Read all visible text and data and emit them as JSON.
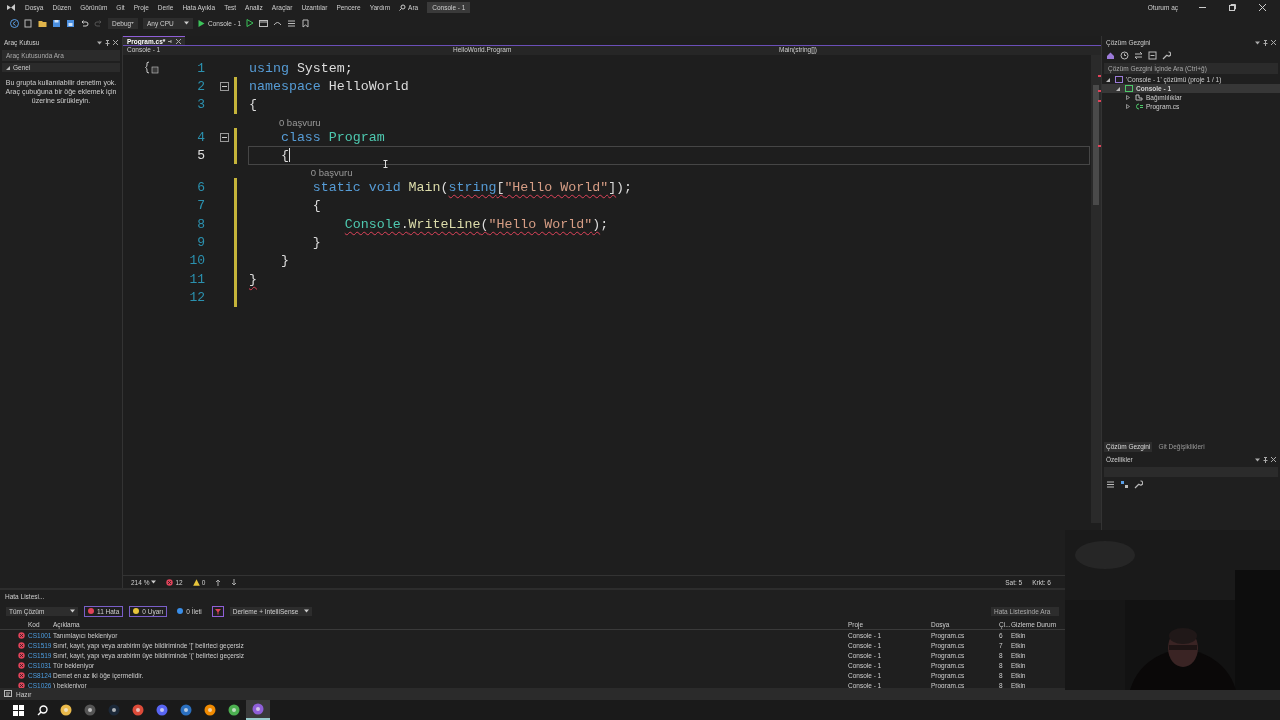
{
  "menu": {
    "items": [
      "Dosya",
      "Düzen",
      "Görünüm",
      "Git",
      "Proje",
      "Derle",
      "Hata Ayıkla",
      "Test",
      "Analiz",
      "Araçlar",
      "Uzantılar",
      "Pencere",
      "Yardım"
    ],
    "search": "Ara",
    "solution_title": "Console - 1",
    "sign_in": "Oturum aç"
  },
  "toolbar": {
    "configuration": "Debug",
    "platform": "Any CPU",
    "start_target": "Console - 1"
  },
  "toolbox": {
    "title": "Araç Kutusu",
    "search_placeholder": "Araç Kutusunda Ara",
    "group": "Genel",
    "message": "Bu grupta kullanılabilir denetim yok. Araç çubuğuna bir öğe eklemek için üzerine sürükleyin."
  },
  "editor": {
    "tabs": [
      {
        "label": "Program.cs*",
        "selected": true
      }
    ],
    "nav": {
      "project": "Console - 1",
      "type": "HelloWorld.Program",
      "member": "Main(string[])"
    },
    "lines": [
      {
        "number": "1",
        "current": false,
        "modified": false,
        "foldable": false,
        "tokens": [
          {
            "text": "using",
            "kind": "keyword",
            "error": false
          },
          {
            "text": " System;",
            "kind": "plain",
            "error": false
          }
        ]
      },
      {
        "number": "2",
        "current": false,
        "modified": true,
        "foldable": true,
        "tokens": [
          {
            "text": "namespace",
            "kind": "keyword",
            "error": false
          },
          {
            "text": " HelloWorld",
            "kind": "plain",
            "error": false
          }
        ]
      },
      {
        "number": "3",
        "current": false,
        "modified": true,
        "foldable": false,
        "tokens": [
          {
            "text": "{",
            "kind": "plain",
            "error": false
          }
        ]
      },
      {
        "number": "4",
        "current": false,
        "modified": true,
        "foldable": true,
        "hint": "0 başvuru",
        "tokens": [
          {
            "text": "    class",
            "kind": "keyword",
            "error": false
          },
          {
            "text": " Program",
            "kind": "type",
            "error": false
          }
        ]
      },
      {
        "number": "5",
        "current": true,
        "modified": true,
        "foldable": false,
        "tokens": [
          {
            "text": "    {",
            "kind": "plain",
            "error": false
          }
        ]
      },
      {
        "number": "6",
        "current": false,
        "modified": true,
        "foldable": false,
        "hint": "0 başvuru",
        "tokens": [
          {
            "text": "        static void",
            "kind": "keyword",
            "error": false
          },
          {
            "text": " Main",
            "kind": "method",
            "error": false
          },
          {
            "text": "(",
            "kind": "plain",
            "error": false
          },
          {
            "text": "string",
            "kind": "keyword",
            "error": true
          },
          {
            "text": "[",
            "kind": "plain",
            "error": true
          },
          {
            "text": "\"Hello World\"",
            "kind": "string",
            "error": true
          },
          {
            "text": "]",
            "kind": "plain",
            "error": true
          },
          {
            "text": ");",
            "kind": "plain",
            "error": false
          }
        ]
      },
      {
        "number": "7",
        "current": false,
        "modified": true,
        "foldable": false,
        "tokens": [
          {
            "text": "        {",
            "kind": "plain",
            "error": false
          }
        ]
      },
      {
        "number": "8",
        "current": false,
        "modified": true,
        "foldable": false,
        "tokens": [
          {
            "text": "            Console",
            "kind": "type",
            "error": true
          },
          {
            "text": ".",
            "kind": "plain",
            "error": true
          },
          {
            "text": "WriteLine",
            "kind": "method",
            "error": true
          },
          {
            "text": "(",
            "kind": "plain",
            "error": true
          },
          {
            "text": "\"Hello World\"",
            "kind": "string",
            "error": true
          },
          {
            "text": ")",
            "kind": "plain",
            "error": true
          },
          {
            "text": ";",
            "kind": "plain",
            "error": false
          }
        ]
      },
      {
        "number": "9",
        "current": false,
        "modified": true,
        "foldable": false,
        "tokens": [
          {
            "text": "        }",
            "kind": "plain",
            "error": false
          }
        ]
      },
      {
        "number": "10",
        "current": false,
        "modified": true,
        "foldable": false,
        "tokens": [
          {
            "text": "    }",
            "kind": "plain",
            "error": false
          }
        ]
      },
      {
        "number": "11",
        "current": false,
        "modified": true,
        "foldable": false,
        "tokens": [
          {
            "text": "}",
            "kind": "plain",
            "error": true
          }
        ]
      },
      {
        "number": "12",
        "current": false,
        "modified": true,
        "foldable": false
      }
    ],
    "status": {
      "zoom": "214 %",
      "errors": "12",
      "warnings": "0",
      "line": "Sat: 5",
      "column": "Krkt: 6"
    }
  },
  "solution_explorer": {
    "title": "Çözüm Gezgini",
    "search_placeholder": "Çözüm Gezgini İçinde Ara (Ctrl+ğ)",
    "tree": [
      {
        "label": "'Console - 1' çözümü (proje 1 / 1)",
        "kind": "solution",
        "selected": false,
        "expanded": true,
        "children": [
          {
            "label": "Console - 1",
            "kind": "project",
            "selected": true,
            "expanded": true,
            "children": [
              {
                "label": "Bağımlılıklar",
                "kind": "dependencies",
                "selected": false,
                "expanded": false
              },
              {
                "label": "Program.cs",
                "kind": "csharp",
                "selected": false,
                "expanded": false
              }
            ]
          }
        ]
      }
    ],
    "tabs": [
      {
        "label": "Çözüm Gezgini",
        "selected": true
      },
      {
        "label": "Git Değişiklikleri",
        "selected": false
      }
    ]
  },
  "properties": {
    "title": "Özellikler"
  },
  "error_list": {
    "title": "Hata Listesi...",
    "scope": "Tüm Çözüm",
    "filters": [
      {
        "label": "11 Hata",
        "kind": "error",
        "selected": true
      },
      {
        "label": "0 Uyarı",
        "kind": "warning",
        "selected": true
      },
      {
        "label": "0 İleti",
        "kind": "info",
        "selected": false
      }
    ],
    "source": "Derleme + IntelliSense",
    "search_placeholder": "Hata Listesinde Ara",
    "columns": [
      "Kod",
      "Açıklama",
      "Proje",
      "Dosya",
      "Çi...",
      "Gizleme Durum"
    ],
    "rows": [
      {
        "code": "CS1001",
        "description": "Tanımlayıcı bekleniyor",
        "project": "Console - 1",
        "file": "Program.cs",
        "line": "6",
        "suppression": "Etkin"
      },
      {
        "code": "CS1519",
        "description": "Sınıf, kayıt, yapı veya arabirim üye bildiriminde '[' belirteci geçersiz",
        "project": "Console - 1",
        "file": "Program.cs",
        "line": "7",
        "suppression": "Etkin"
      },
      {
        "code": "CS1519",
        "description": "Sınıf, kayıt, yapı veya arabirim üye bildiriminde '(' belirteci geçersiz",
        "project": "Console - 1",
        "file": "Program.cs",
        "line": "8",
        "suppression": "Etkin"
      },
      {
        "code": "CS1031",
        "description": "Tür bekleniyor",
        "project": "Console - 1",
        "file": "Program.cs",
        "line": "8",
        "suppression": "Etkin"
      },
      {
        "code": "CS8124",
        "description": "Demet en az iki öğe içermelidir.",
        "project": "Console - 1",
        "file": "Program.cs",
        "line": "8",
        "suppression": "Etkin"
      },
      {
        "code": "CS1026",
        "description": ") bekleniyor",
        "project": "Console - 1",
        "file": "Program.cs",
        "line": "8",
        "suppression": "Etkin"
      }
    ]
  },
  "status_bar": {
    "text": "Hazır"
  },
  "taskbar": {
    "apps": [
      {
        "kind": "start",
        "selected": false
      },
      {
        "kind": "search",
        "selected": false
      },
      {
        "kind": "folder",
        "selected": false
      },
      {
        "kind": "recorder",
        "selected": false
      },
      {
        "kind": "steam",
        "selected": false
      },
      {
        "kind": "chrome",
        "selected": false
      },
      {
        "kind": "discord",
        "selected": false
      },
      {
        "kind": "editor",
        "selected": false
      },
      {
        "kind": "cone",
        "selected": false
      },
      {
        "kind": "notepad",
        "selected": false
      },
      {
        "kind": "studio",
        "selected": true
      }
    ]
  }
}
